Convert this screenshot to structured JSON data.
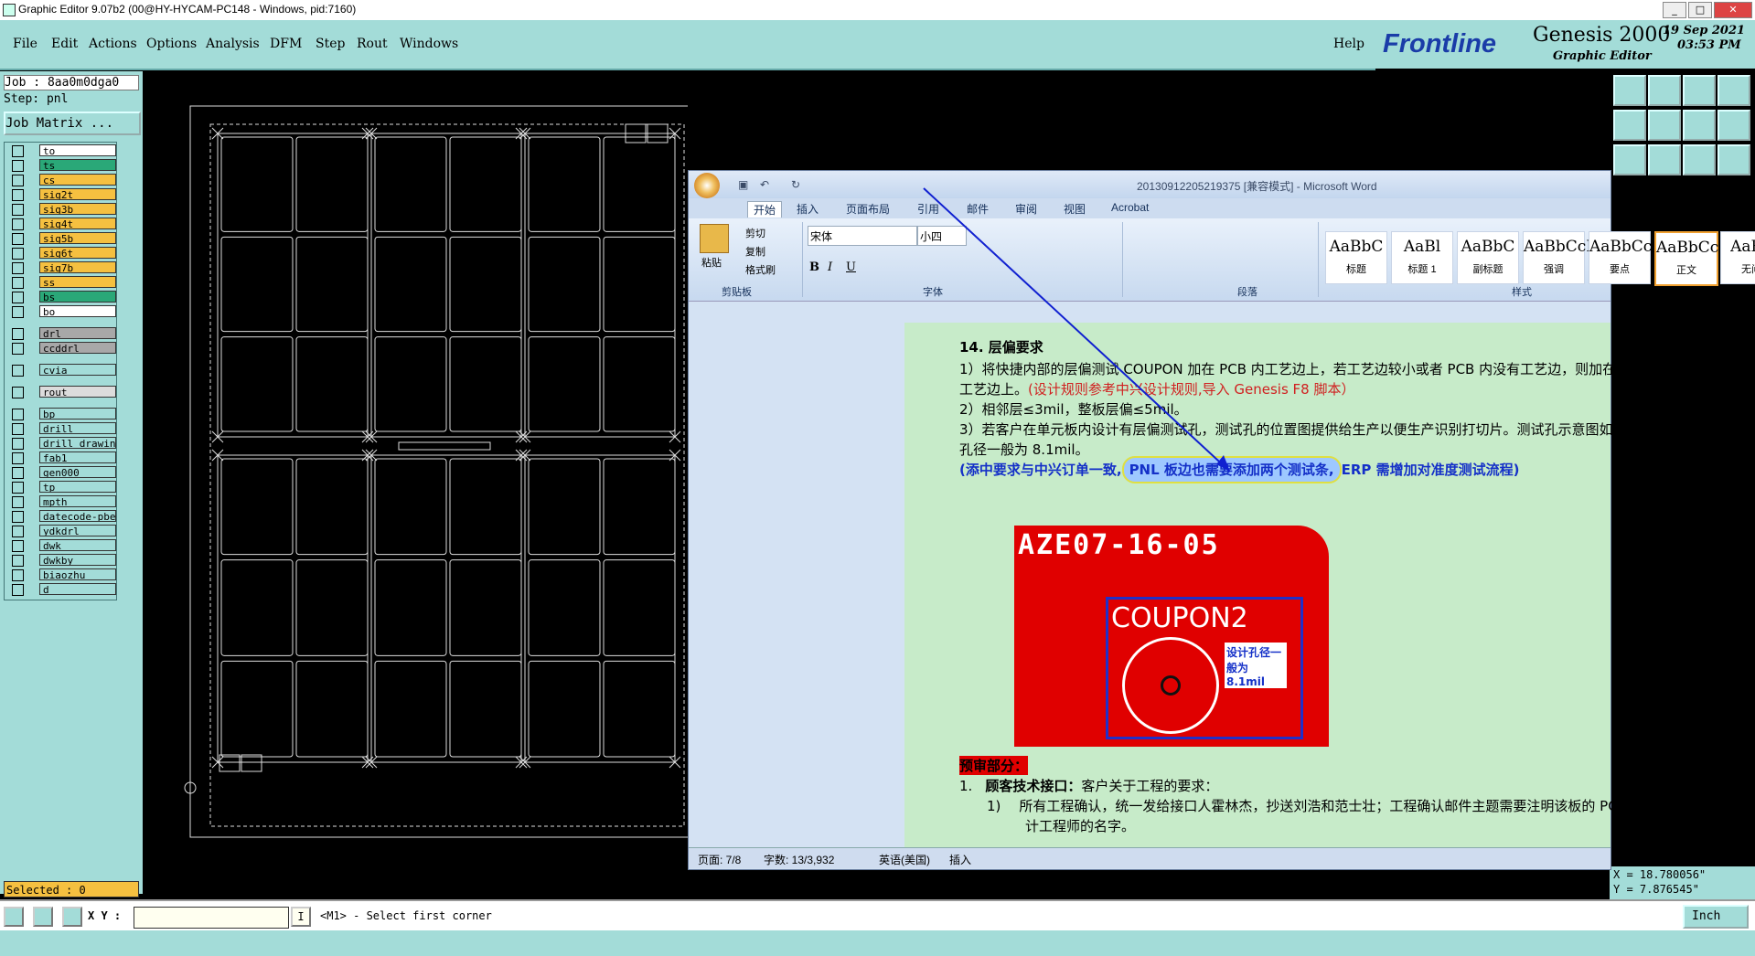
{
  "titlebar": {
    "title": "Graphic Editor 9.07b2 (00@HY-HYCAM-PC148 - Windows, pid:7160)"
  },
  "menu": {
    "items": [
      "File",
      "Edit",
      "Actions",
      "Options",
      "Analysis",
      "DFM",
      "Step",
      "Rout",
      "Windows"
    ],
    "help": "Help"
  },
  "brand": {
    "logo": "Frontline",
    "product": "Genesis 2000",
    "subtitle": "Graphic Editor",
    "date": "19 Sep 2021",
    "time": "03:53 PM"
  },
  "job": {
    "job_line": "Job : 8aa0m0dga0",
    "step_line": "Step: pnl",
    "matrix_button": "Job Matrix ..."
  },
  "layers": [
    {
      "name": "to",
      "color": "#ffffff"
    },
    {
      "name": "ts",
      "color": "#2aa878"
    },
    {
      "name": "cs",
      "color": "#f5c040"
    },
    {
      "name": "sig2t",
      "color": "#f5c040"
    },
    {
      "name": "sig3b",
      "color": "#f5c040"
    },
    {
      "name": "sig4t",
      "color": "#f5c040"
    },
    {
      "name": "sig5b",
      "color": "#f5c040"
    },
    {
      "name": "sig6t",
      "color": "#f5c040"
    },
    {
      "name": "sig7b",
      "color": "#f5c040"
    },
    {
      "name": "ss",
      "color": "#f5c040"
    },
    {
      "name": "bs",
      "color": "#2aa878"
    },
    {
      "name": "bo",
      "color": "#ffffff"
    },
    {
      "name": "drl",
      "color": "#a8a8a8"
    },
    {
      "name": "ccddrl",
      "color": "#a8a8a8"
    },
    {
      "name": "cvia",
      "color": "#a3dcd8"
    },
    {
      "name": "rout",
      "color": "#dcdcdc"
    },
    {
      "name": "bp",
      "color": "#a3dcd8"
    },
    {
      "name": "drill",
      "color": "#a3dcd8"
    },
    {
      "name": "drill_drawin",
      "color": "#a3dcd8"
    },
    {
      "name": "fab1",
      "color": "#a3dcd8"
    },
    {
      "name": "gen000",
      "color": "#a3dcd8"
    },
    {
      "name": "tp",
      "color": "#a3dcd8"
    },
    {
      "name": "mpth",
      "color": "#a3dcd8"
    },
    {
      "name": "datecode-pbe",
      "color": "#a3dcd8"
    },
    {
      "name": "ydkdrl",
      "color": "#a3dcd8"
    },
    {
      "name": "dwk",
      "color": "#a3dcd8"
    },
    {
      "name": "dwkby",
      "color": "#a3dcd8"
    },
    {
      "name": "biaozhu",
      "color": "#a3dcd8"
    },
    {
      "name": "d",
      "color": "#a3dcd8"
    }
  ],
  "status": {
    "selected": "Selected : 0",
    "xy_label": "X Y :",
    "xy_value": "",
    "prompt": "<M1> - Select first corner",
    "units": "Inch"
  },
  "coords": {
    "x": "X = 18.780056\"",
    "y": "Y = 7.876545\""
  },
  "word": {
    "title": "20130912205219375 [兼容模式] - Microsoft Word",
    "tabs": [
      "开始",
      "插入",
      "页面布局",
      "引用",
      "邮件",
      "审阅",
      "视图",
      "Acrobat"
    ],
    "clipboard": {
      "paste": "粘贴",
      "cut": "剪切",
      "copy": "复制",
      "format_painter": "格式刷",
      "group": "剪贴板"
    },
    "font": {
      "name": "宋体",
      "size": "小四",
      "group": "字体"
    },
    "paragraph_group": "段落",
    "styles_group": "样式",
    "styles": [
      {
        "preview": "AaBbC",
        "name": "标题"
      },
      {
        "preview": "AaBl",
        "name": "标题 1"
      },
      {
        "preview": "AaBbC",
        "name": "副标题"
      },
      {
        "preview": "AaBbCcD",
        "name": "强调"
      },
      {
        "preview": "AaBbCcD",
        "name": "要点"
      },
      {
        "preview": "AaBbCcD",
        "name": "正文"
      },
      {
        "preview": "AaBb",
        "name": "无间"
      }
    ],
    "doc": {
      "heading": "14. 层偏要求",
      "line1": "1）将快捷内部的层偏测试 COUPON 加在 PCB 内工艺边上，若工艺边较小或者 PCB 内没有工艺边，则加在 PNL",
      "line2a": "工艺边上。",
      "line2b": "(设计规则参考中兴设计规则,导入 Genesis F8 脚本）",
      "line3": "2）相邻层≤3mil，整板层偏≤5mil。",
      "line4": "3）若客户在单元板内设计有层偏测试孔，测试孔的位置图提供给生产以便生产识别打切片。测试孔示意图如下,",
      "line5": "孔径一般为 8.1mil。",
      "note_a": "(添中要求与中兴订单一致,",
      "note_b": "PNL 板边也需要添加两个测试条,",
      "note_c": "ERP 需增加对准度测试流程)",
      "image_text1": "AZE07-16-05",
      "image_text2": "COUPON2",
      "image_callout": "设计孔径一般为8.1mil",
      "section": "预审部分：",
      "item1_num": "1.",
      "item1_title": "顾客技术接口：",
      "item1_text": "客户关于工程的要求：",
      "sub1_num": "1)",
      "sub1_text": "所有工程确认，统一发给接口人霍林杰，抄送刘浩和范士壮；工程确认邮件主题需要注明该板的 PCB 设",
      "sub1_text2": "计工程师的名字。"
    },
    "statusbar": {
      "page": "页面: 7/8",
      "words": "字数: 13/3,932",
      "lang": "英语(美国)",
      "mode": "插入"
    }
  }
}
